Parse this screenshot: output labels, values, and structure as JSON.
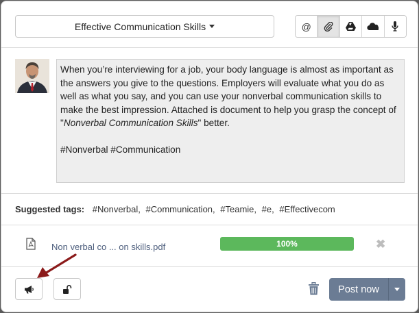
{
  "header": {
    "group_name": "Effective Communication Skills",
    "tools": [
      {
        "icon": "at-icon",
        "active": false
      },
      {
        "icon": "paperclip-icon",
        "active": true
      },
      {
        "icon": "google-drive-icon",
        "active": false
      },
      {
        "icon": "cloud-icon",
        "active": false
      },
      {
        "icon": "microphone-icon",
        "active": false
      }
    ]
  },
  "post": {
    "line1": "When you’re interviewing for a job, your body language is almost as important as the answers you give to the questions. Employers will evaluate what you do as well as what you say, and you can use your nonverbal communication skills to make the best impression. Attached is document to help you grasp the concept of \"",
    "italic_phrase": "Nonverbal Communication Skills",
    "line1_end": "\" better.",
    "hashtags": "#Nonverbal #Communication"
  },
  "suggested": {
    "label": "Suggested tags:",
    "tags": [
      "#Nonverbal,",
      "#Communication,",
      "#Teamie,",
      "#e,",
      "#Effectivecom"
    ]
  },
  "attachment": {
    "file_name": "Non verbal co ... on skills.pdf",
    "progress_label": "100%",
    "progress_fraction": 1.0,
    "remove_glyph": "✖"
  },
  "footer": {
    "post_label": "Post now"
  },
  "colors": {
    "progress": "#5cb85c",
    "post_button": "#6b7c94",
    "arrow": "#8b1a1a",
    "file_link": "#4c5d7c"
  }
}
